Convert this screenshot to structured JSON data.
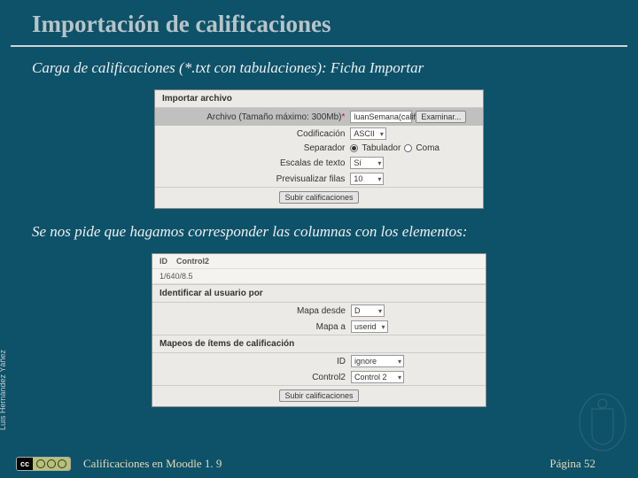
{
  "title": "Importación de calificaciones",
  "section1": "Carga de calificaciones (*.txt con tabulaciones): Ficha Importar",
  "section2": "Se nos pide que hagamos corresponder las columnas con los elementos:",
  "screenshot1": {
    "tab": "Importar archivo",
    "file_label": "Archivo (Tamaño máximo: 300Mb)",
    "file_value": "luanSemana(calific",
    "browse_button": "Examinar...",
    "encoding_label": "Codificación",
    "encoding_value": "ASCII",
    "separator_label": "Separador",
    "sep_tab": "Tabulador",
    "sep_comma": "Coma",
    "textscale_label": "Escalas de texto",
    "textscale_value": "Sí",
    "preview_label": "Previsualizar filas",
    "preview_value": "10",
    "submit_button": "Subir calificaciones"
  },
  "screenshot2": {
    "header_id": "ID",
    "header_c2": "Control2",
    "data_row": "1/640/8.5",
    "sectionA": "Identificar al usuario por",
    "map_from_label": "Mapa desde",
    "map_from_value": "D",
    "map_to_label": "Mapa a",
    "map_to_value": "userid",
    "sectionB": "Mapeos de ítems de calificación",
    "id_label": "ID",
    "id_value": "ignore",
    "c2_label": "Control2",
    "c2_value": "Control 2",
    "submit_button": "Subir calificaciones"
  },
  "author": "Luis Hernández Yáñez",
  "footer": "Calificaciones en Moodle 1. 9",
  "page": "Página 52",
  "license": {
    "left": "cc",
    "terms": [
      "BY",
      "NC",
      "SA"
    ]
  }
}
